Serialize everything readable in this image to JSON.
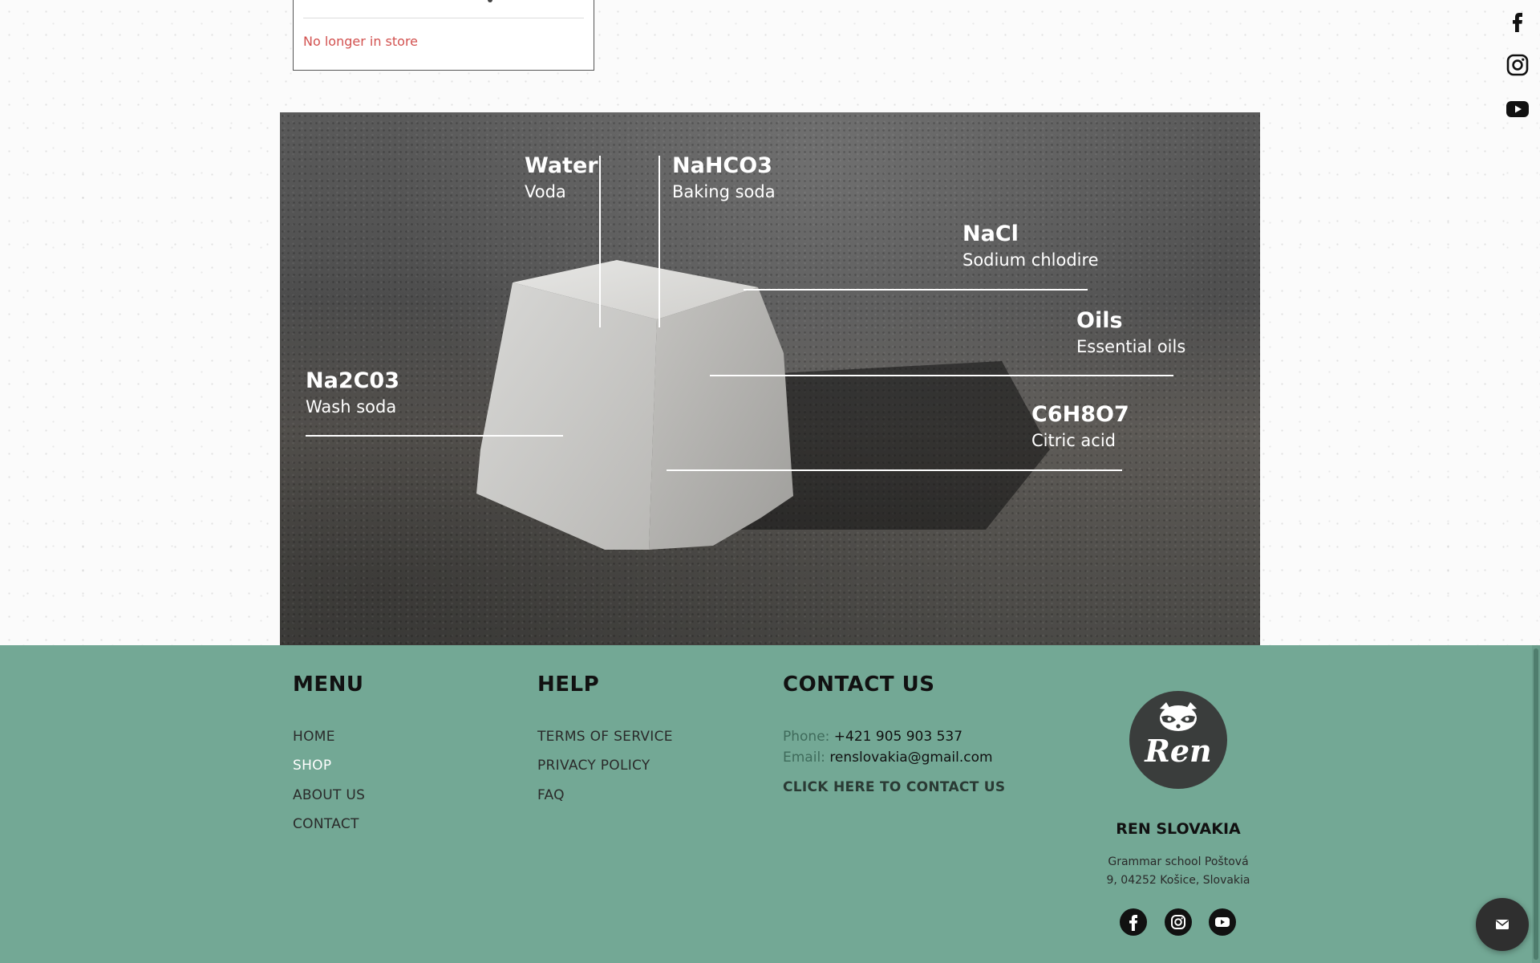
{
  "product_card": {
    "status": "No longer in store",
    "status_color": "#d2514f"
  },
  "social_rail": {
    "icons": [
      "facebook-icon",
      "instagram-icon",
      "youtube-icon"
    ]
  },
  "ingredients": [
    {
      "formula": "Water",
      "name": "Voda"
    },
    {
      "formula": "NaHCO3",
      "name": "Baking soda"
    },
    {
      "formula": "NaCl",
      "name": "Sodium chlodire"
    },
    {
      "formula": "Oils",
      "name": "Essential oils"
    },
    {
      "formula": "Na2C03",
      "name": "Wash soda"
    },
    {
      "formula": "C6H8O7",
      "name": "Citric acid"
    }
  ],
  "footer": {
    "background": "#73a895",
    "menu": {
      "title": "MENU",
      "items": [
        "HOME",
        "SHOP",
        "ABOUT US",
        "CONTACT"
      ],
      "active": "SHOP"
    },
    "help": {
      "title": "HELP",
      "items": [
        "TERMS OF SERVICE",
        "PRIVACY POLICY",
        "FAQ"
      ]
    },
    "contact": {
      "title": "CONTACT US",
      "phone_label": "Phone:",
      "phone": "+421 905 903 537",
      "email_label": "Email:",
      "email": "renslovakia@gmail.com",
      "cta": "CLICK HERE TO CONTACT US"
    },
    "brand": {
      "logo_text": "Ren",
      "name": "REN SLOVAKIA",
      "address_line1": "Grammar school Poštová",
      "address_line2": "9, 04252 Košice, Slovakia"
    },
    "social_icons": [
      "facebook-icon",
      "instagram-icon",
      "youtube-icon"
    ]
  },
  "chat": {
    "icon": "envelope-icon"
  }
}
